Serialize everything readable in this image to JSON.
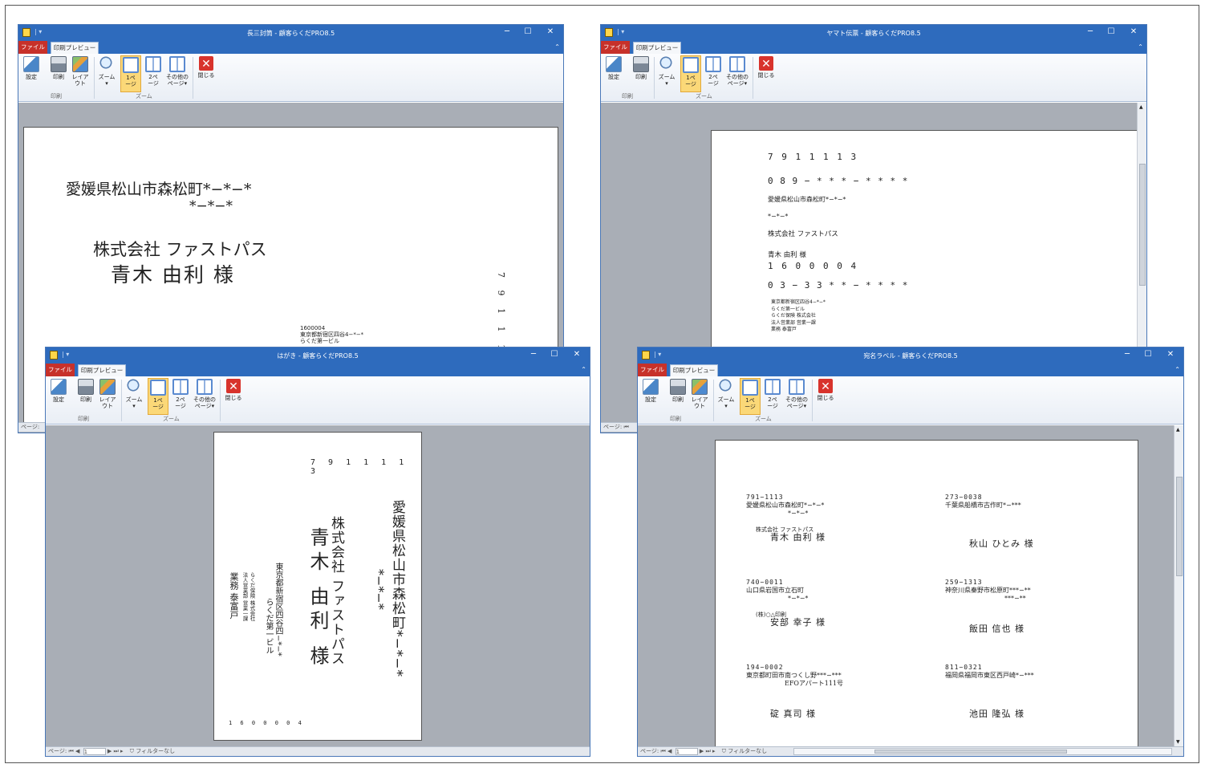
{
  "common": {
    "tab_file": "ファイル",
    "tab_preview": "印刷プレビュー",
    "btn_settings": "設定",
    "btn_print": "印刷",
    "btn_layout_1": "レイア",
    "btn_layout_2": "ウト",
    "btn_zoom": "ズーム",
    "btn_page1_1": "1ペ",
    "btn_page1_2": "ージ",
    "btn_page2_1": "2ペ",
    "btn_page2_2": "ージ",
    "btn_other_1": "その他の",
    "btn_other_2": "ページ",
    "btn_close": "閉じる",
    "group_print": "印刷",
    "group_zoom": "ズーム",
    "status_page": "ページ:",
    "status_page_value": "1",
    "status_filter": "フィルターなし",
    "minimize": "─",
    "maximize": "☐",
    "close": "✕"
  },
  "window1": {
    "title": "長三封筒 - 顧客らくだPRO8.5",
    "addr1": "愛媛県松山市森松町*−*−*",
    "addr2": "*−*−*",
    "company": "株式会社 ファストパス",
    "name": "青木 由利 様",
    "zip_vertical": "7 9 1 1 1",
    "sender_zip": "1600004",
    "sender_addr": "東京都新宿区四谷4−*−*",
    "sender_bldg": "らくだ第一ビル"
  },
  "window2": {
    "title": "ヤマト伝票 - 顧客らくだPRO8.5",
    "to_zip": "7 9 1   1 1 1 3",
    "to_tel": "0 8 9 − * * * − * * * *",
    "to_addr": "愛媛県松山市森松町*−*−*",
    "to_addr2": "*−*−*",
    "to_company": "株式会社 ファストパス",
    "to_name": "青木 由利 様",
    "from_zip": "1 6 0   0 0 0 4",
    "from_tel": "0 3 − 3 3 * * − * * * *",
    "from_addr": "東京都新宿区四谷4−*−*",
    "from_bldg": "らくだ第一ビル",
    "from_company": "らくだ保険 株式会社",
    "from_dept": "法人営業部 営業一課",
    "from_person": "業務 泰富戸"
  },
  "window3": {
    "title": "はがき - 顧客らくだPRO8.5",
    "zip": "7 9 1 1 1 1 3",
    "addr1": "愛媛県松山市森松町*−*−*",
    "addr2": "*−*−*",
    "company": "株式会社 ファストパス",
    "name": "青木 由利 様",
    "sender_addr": "東京都新宿区四谷四−*−*",
    "sender_bldg": "らくだ第一ビル",
    "sender_company": "らくだ保険 株式会社",
    "sender_dept": "法人営業部 営業一課",
    "sender_person": "業務 泰富戸",
    "sender_zip": "1 6 0 0 0 0 4"
  },
  "window4": {
    "title": "宛名ラベル - 顧客らくだPRO8.5",
    "labels": [
      {
        "zip": "791−1113",
        "addr": "愛媛県松山市森松町*−*−*",
        "addr2": "*−*−*",
        "company": "株式会社 ファストパス",
        "name": "青木 由利 様"
      },
      {
        "zip": "273−0038",
        "addr": "千葉県船橋市古作町*−***",
        "addr2": "",
        "company": "",
        "name": "秋山 ひとみ 様"
      },
      {
        "zip": "740−0011",
        "addr": "山口県岩国市立石町",
        "addr2": "*−*−*",
        "company": "(株)○△印刷",
        "name": "安部 幸子 様"
      },
      {
        "zip": "259−1313",
        "addr": "神奈川県秦野市松原町***−**",
        "addr2": "***−**",
        "company": "",
        "name": "飯田 信也 様"
      },
      {
        "zip": "194−0002",
        "addr": "東京都町田市南つくし野***−***",
        "addr2": "EFOアパート111号",
        "company": "",
        "name": "碇 真司 様"
      },
      {
        "zip": "811−0321",
        "addr": "福岡県福岡市東区西戸崎*−***",
        "addr2": "",
        "company": "",
        "name": "池田 隆弘 様"
      }
    ]
  }
}
